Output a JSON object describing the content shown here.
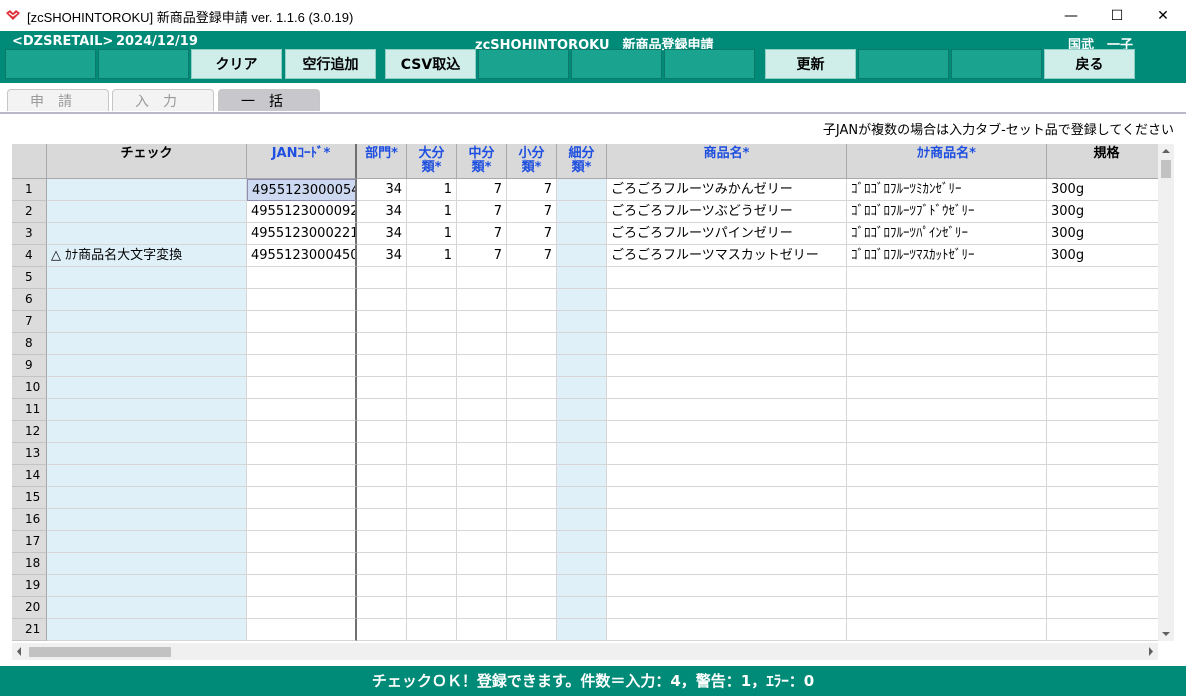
{
  "window": {
    "title": "[zcSHOHINTOROKU] 新商品登録申請 ver. 1.1.6 (3.0.19)",
    "minimize": "—",
    "maximize": "☐",
    "close": "✕"
  },
  "header": {
    "system": "<DZSRETAIL>",
    "date": "2024/12/19",
    "program": "zcSHOHINTOROKU　新商品登録申請",
    "user": "国武　一子"
  },
  "toolbar": {
    "buttons": [
      "",
      "",
      "クリア",
      "空行追加",
      "CSV取込",
      "",
      "",
      "",
      "更新",
      "",
      "",
      "戻る"
    ]
  },
  "tabs": [
    {
      "label": "申請",
      "selected": false
    },
    {
      "label": "入力",
      "selected": false
    },
    {
      "label": "一括",
      "selected": true
    }
  ],
  "note": "子JANが複数の場合は入力タブ-セット品で登録してください",
  "table": {
    "columns": [
      {
        "label": "チェック",
        "label2": "",
        "required": false
      },
      {
        "label": "JANｺｰﾄﾞ*",
        "label2": "",
        "required": true
      },
      {
        "label": "部門*",
        "label2": "",
        "required": true
      },
      {
        "label": "大分",
        "label2": "類*",
        "required": true
      },
      {
        "label": "中分",
        "label2": "類*",
        "required": true
      },
      {
        "label": "小分",
        "label2": "類*",
        "required": true
      },
      {
        "label": "細分",
        "label2": "類*",
        "required": true
      },
      {
        "label": "商品名*",
        "label2": "",
        "required": true
      },
      {
        "label": "ｶﾅ商品名*",
        "label2": "",
        "required": true
      },
      {
        "label": "規格",
        "label2": "",
        "required": false
      }
    ],
    "rows": [
      {
        "no": "1",
        "check": "",
        "jan": "4955123000054",
        "bumon": "34",
        "dai": "1",
        "chu": "7",
        "sho": "7",
        "sai": "",
        "name": "ごろごろフルーツみかんゼリー",
        "kana": "ｺﾞﾛｺﾞﾛﾌﾙｰﾂﾐｶﾝｾﾞﾘｰ",
        "kikaku": "300g"
      },
      {
        "no": "2",
        "check": "",
        "jan": "4955123000092",
        "bumon": "34",
        "dai": "1",
        "chu": "7",
        "sho": "7",
        "sai": "",
        "name": "ごろごろフルーツぶどうゼリー",
        "kana": "ｺﾞﾛｺﾞﾛﾌﾙｰﾂﾌﾞﾄﾞｳｾﾞﾘｰ",
        "kikaku": "300g"
      },
      {
        "no": "3",
        "check": "",
        "jan": "4955123000221",
        "bumon": "34",
        "dai": "1",
        "chu": "7",
        "sho": "7",
        "sai": "",
        "name": "ごろごろフルーツパインゼリー",
        "kana": "ｺﾞﾛｺﾞﾛﾌﾙｰﾂﾊﾟｲﾝｾﾞﾘｰ",
        "kikaku": "300g"
      },
      {
        "no": "4",
        "check": "△ ｶﾅ商品名大文字変換",
        "jan": "4955123000450",
        "bumon": "34",
        "dai": "1",
        "chu": "7",
        "sho": "7",
        "sai": "",
        "name": "ごろごろフルーツマスカットゼリー",
        "kana": "ｺﾞﾛｺﾞﾛﾌﾙｰﾂﾏｽｶｯﾄｾﾞﾘｰ",
        "kikaku": "300g"
      },
      {
        "no": "5"
      },
      {
        "no": "6"
      },
      {
        "no": "7"
      },
      {
        "no": "8"
      },
      {
        "no": "9"
      },
      {
        "no": "10"
      },
      {
        "no": "11"
      },
      {
        "no": "12"
      },
      {
        "no": "13"
      },
      {
        "no": "14"
      },
      {
        "no": "15"
      },
      {
        "no": "16"
      },
      {
        "no": "17"
      },
      {
        "no": "18"
      },
      {
        "no": "19"
      },
      {
        "no": "20"
      },
      {
        "no": "21"
      }
    ]
  },
  "status": "チェックＯＫ！登録できます。件数＝入力：4，警告：1，ｴﾗｰ：0",
  "colors": {
    "header_green": "#008a78",
    "required_blue": "#1e4fe0",
    "check_column_bg": "#e0f0f9"
  },
  "icons": [
    "app-icon",
    "scroll-up-icon",
    "scroll-down-icon",
    "scroll-left-icon",
    "scroll-right-icon"
  ]
}
